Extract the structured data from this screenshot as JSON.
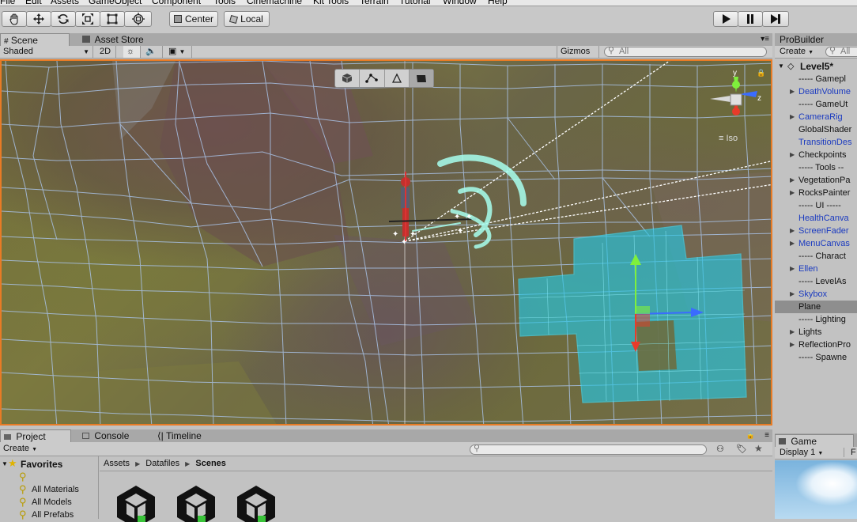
{
  "menu": [
    "File",
    "Edit",
    "Assets",
    "GameObject",
    "Component",
    "Tools",
    "Cinemachine",
    "Kit Tools",
    "Terrain",
    "Tutorial",
    "Window",
    "Help"
  ],
  "toolbar": {
    "tools": [
      "hand-icon",
      "move-icon",
      "rotate-icon",
      "scale-icon",
      "rect-icon",
      "transform-icon"
    ],
    "pivot_label": "Center",
    "space_label": "Local",
    "play": [
      "play-icon",
      "pause-icon",
      "step-icon"
    ]
  },
  "scene": {
    "tabs": [
      "Scene",
      "Asset Store"
    ],
    "shading": "Shaded",
    "mode_2d": "2D",
    "gizmos": "Gizmos",
    "search_placeholder": "All",
    "axis_labels": {
      "y": "y",
      "z": "z"
    },
    "projection": "Iso"
  },
  "probuilder": {
    "title": "ProBuilder"
  },
  "hierarchy": {
    "create": "Create",
    "search_placeholder": "All",
    "root": "Level5*",
    "items": [
      {
        "label": "----- Gamepl",
        "arrow": false,
        "blue": false,
        "selected": false
      },
      {
        "label": "DeathVolume",
        "arrow": true,
        "blue": true,
        "selected": false
      },
      {
        "label": "----- GameUt",
        "arrow": false,
        "blue": false,
        "selected": false
      },
      {
        "label": "CameraRig",
        "arrow": true,
        "blue": true,
        "selected": false
      },
      {
        "label": "GlobalShader",
        "arrow": false,
        "blue": false,
        "selected": false
      },
      {
        "label": "TransitionDes",
        "arrow": false,
        "blue": true,
        "selected": false
      },
      {
        "label": "Checkpoints",
        "arrow": true,
        "blue": false,
        "selected": false
      },
      {
        "label": "----- Tools --",
        "arrow": false,
        "blue": false,
        "selected": false
      },
      {
        "label": "VegetationPa",
        "arrow": true,
        "blue": false,
        "selected": false
      },
      {
        "label": "RocksPainter",
        "arrow": true,
        "blue": false,
        "selected": false
      },
      {
        "label": "----- UI -----",
        "arrow": false,
        "blue": false,
        "selected": false
      },
      {
        "label": "HealthCanva",
        "arrow": false,
        "blue": true,
        "selected": false
      },
      {
        "label": "ScreenFader",
        "arrow": true,
        "blue": true,
        "selected": false
      },
      {
        "label": "MenuCanvas",
        "arrow": true,
        "blue": true,
        "selected": false
      },
      {
        "label": "----- Charact",
        "arrow": false,
        "blue": false,
        "selected": false
      },
      {
        "label": "Ellen",
        "arrow": true,
        "blue": true,
        "selected": false
      },
      {
        "label": "----- LevelAs",
        "arrow": false,
        "blue": false,
        "selected": false
      },
      {
        "label": "Skybox",
        "arrow": true,
        "blue": true,
        "selected": false
      },
      {
        "label": "Plane",
        "arrow": false,
        "blue": false,
        "selected": true
      },
      {
        "label": "----- Lighting",
        "arrow": false,
        "blue": false,
        "selected": false
      },
      {
        "label": "Lights",
        "arrow": true,
        "blue": false,
        "selected": false
      },
      {
        "label": "ReflectionPro",
        "arrow": true,
        "blue": false,
        "selected": false
      },
      {
        "label": "----- Spawne",
        "arrow": false,
        "blue": false,
        "selected": false
      }
    ]
  },
  "game": {
    "tab": "Game",
    "display": "Display 1",
    "extra": "F"
  },
  "project": {
    "tabs": [
      "Project",
      "Console",
      "Timeline"
    ],
    "create": "Create",
    "favorites_title": "Favorites",
    "favorites": [
      "All Materials",
      "All Models",
      "All Prefabs"
    ],
    "breadcrumb": [
      "Assets",
      "Datafiles",
      "Scenes"
    ]
  },
  "colors": {
    "accent": "#e87b25",
    "selection_mesh": "#26c6e3",
    "hierarchy_link": "#1a3ac0"
  }
}
